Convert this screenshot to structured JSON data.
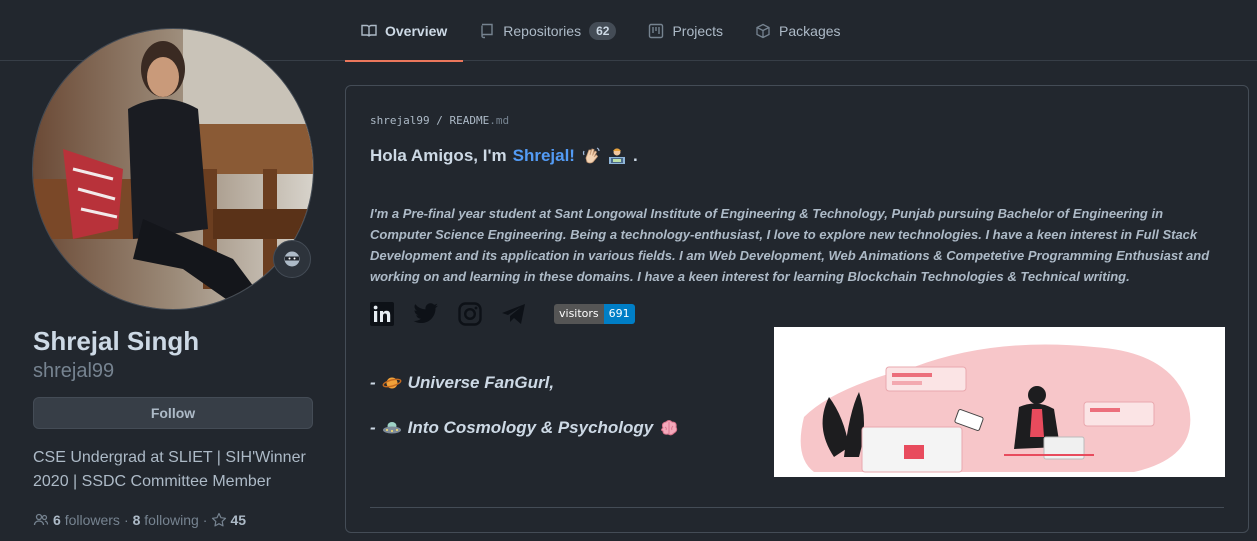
{
  "tabs": [
    {
      "label": "Overview",
      "icon": "book-icon",
      "active": true
    },
    {
      "label": "Repositories",
      "icon": "repo-icon",
      "count": "62"
    },
    {
      "label": "Projects",
      "icon": "project-icon"
    },
    {
      "label": "Packages",
      "icon": "package-icon"
    }
  ],
  "profile": {
    "name": "Shrejal Singh",
    "username": "shrejal99",
    "follow_label": "Follow",
    "bio": "CSE Undergrad at SLIET | SIH'Winner 2020 | SSDC Committee Member",
    "followers_count": "6",
    "followers_label": "followers",
    "following_count": "8",
    "following_label": "following",
    "stars_count": "45",
    "status_icon": "ninja-icon"
  },
  "readme": {
    "owner": "shrejal99",
    "separator": "/",
    "file": "README",
    "ext": ".md",
    "greeting_prefix": "Hola Amigos, I'm",
    "greeting_name": "Shrejal!",
    "greeting_suffix": ".",
    "intro": "I'm a Pre-final year student at Sant Longowal Institute of Engineering & Technology, Punjab pursuing Bachelor of Engineering in Computer Science Engineering. Being a technology-enthusiast, I love to explore new technologies. I have a keen interest in Full Stack Development and its application in various fields. I am Web Development, Web Animations & Competetive Programming Enthusiast and working on and learning in these domains. I have a keen interest for learning Blockchain Technologies & Technical writing.",
    "social_icons": [
      "linkedin-icon",
      "twitter-icon",
      "instagram-icon",
      "telegram-icon"
    ],
    "badge": {
      "label": "visitors",
      "value": "691"
    },
    "bullets": [
      {
        "prefix": "-",
        "text": "Universe FanGurl,",
        "icon": "planet-icon"
      },
      {
        "prefix": "-",
        "text": "Into Cosmology & Psychology",
        "icon": "ufo-icon",
        "trail_icon": "brain-icon"
      }
    ]
  },
  "colors": {
    "bg": "#22272e",
    "accent_tab": "#ec775c",
    "link": "#539bf5",
    "badge_value": "#007ec6"
  }
}
